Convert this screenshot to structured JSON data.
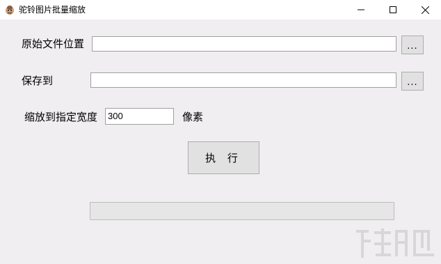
{
  "window": {
    "title": "驼铃图片批量缩放",
    "icons": [
      "app-icon",
      "minimize-icon",
      "maximize-icon",
      "close-icon"
    ]
  },
  "form": {
    "source_label": "原始文件位置",
    "source_value": "",
    "source_browse": "...",
    "save_label": "保存到",
    "save_value": "",
    "save_browse": "...",
    "width_label": "缩放到指定宽度",
    "width_value": "300",
    "unit_label": "像素"
  },
  "actions": {
    "execute_label": "执 行"
  },
  "progress": {
    "value": 0
  },
  "colors": {
    "window_bg": "#f0eef0",
    "titlebar_bg": "#ffffff",
    "button_bg": "#e1e1e1"
  }
}
